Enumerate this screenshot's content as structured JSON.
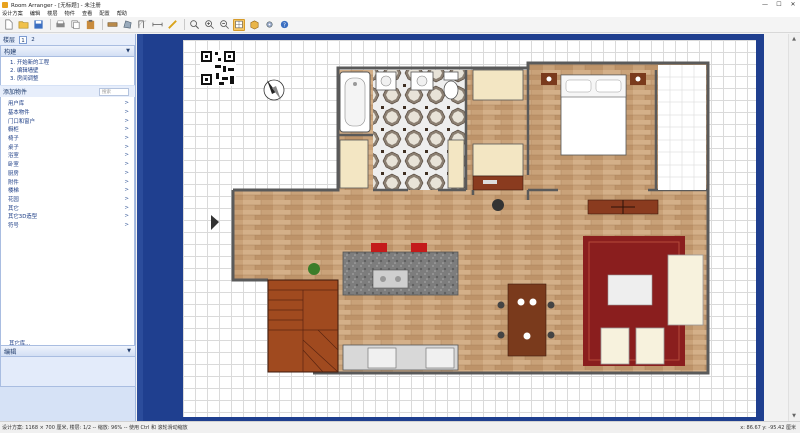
{
  "app": {
    "title": "Room Arranger - [无标题] - 未注册"
  },
  "window_buttons": {
    "minimize": "—",
    "maximize": "☐",
    "close": "✕"
  },
  "menu": [
    "设计方案",
    "编辑",
    "楼层",
    "物件",
    "查看",
    "配置",
    "帮助"
  ],
  "toolbar": {
    "tools": [
      {
        "icon": "new-file-icon"
      },
      {
        "icon": "open-folder-icon"
      },
      {
        "icon": "save-icon"
      },
      {
        "icon": "print-icon"
      },
      {
        "icon": "copy-icon"
      },
      {
        "icon": "paste-icon"
      },
      {
        "icon": "wall-icon"
      },
      {
        "icon": "polygon-icon"
      },
      {
        "icon": "door-icon"
      },
      {
        "icon": "dimension-icon"
      },
      {
        "icon": "measure-icon"
      },
      {
        "icon": "zoom-fit-icon"
      },
      {
        "icon": "zoom-in-icon"
      },
      {
        "icon": "zoom-out-icon"
      },
      {
        "icon": "view-2d-icon"
      },
      {
        "icon": "view-3d-icon"
      },
      {
        "icon": "settings-icon"
      },
      {
        "icon": "help-icon"
      }
    ]
  },
  "sidebar": {
    "floor": {
      "label": "楼层",
      "tabs": [
        "1",
        "2"
      ],
      "selected": "1"
    },
    "build": {
      "title": "构建",
      "items": [
        "1. 开始新的工程",
        "2. 编辑墙壁",
        "3. 房间调整"
      ]
    },
    "add_objects": {
      "title": "添加物件",
      "search_placeholder": "搜索"
    },
    "categories": [
      "用户库",
      "基本物件",
      "门口和窗户",
      "橱柜",
      "椅子",
      "桌子",
      "浴室",
      "卧室",
      "厨房",
      "附件",
      "楼梯",
      "花园",
      "其它",
      "其它3D造型",
      "符号"
    ],
    "more_label": "其它库...",
    "edit": {
      "title": "编辑"
    }
  },
  "statusbar": {
    "text": "设计方案: 1168 × 700 厘米, 楼层: 1/2 -- 缩放: 96% -- 使用 Ctrl 和 滚轮滑动缩放",
    "coords": "x: 86.67  y: -95.42 厘米"
  },
  "colors": {
    "accent": "#f6c86a",
    "sidebar": "#d6e2f6",
    "canvas_bg": "#1f3f8f",
    "wood_floor": "#c9a279",
    "carpet": "#8a1e1e",
    "stairs": "#a04a1f"
  }
}
